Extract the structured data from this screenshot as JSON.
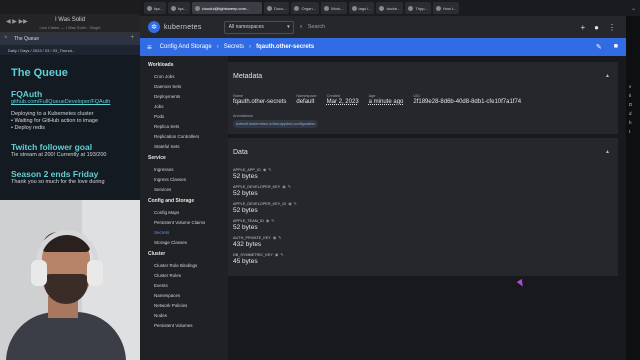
{
  "music": {
    "title": "I Was Solid",
    "subtitle": "Lew Clarke — I Was Solid - Single"
  },
  "obsidian": {
    "tab_label": "The Queue",
    "breadcrumb": "Daily / Days / 2023 / 03 / 03_Thursd...",
    "title": "The Queue",
    "section1_title": "FQAuth",
    "section1_link": "github.com/FullQueueDeveloper/FQAuth",
    "section1_lines": [
      "Deploying to a Kubernetes cluster",
      "• Waiting for GitHub action to image",
      "• Deploy redis"
    ],
    "section2_title": "Twitch follower goal",
    "section2_text": "Tie stream at 200! Currently at 193/200",
    "section3_title": "Season 2 ends Friday",
    "section3_text": "Thank you so much for the love during"
  },
  "browser": {
    "tabs": [
      "fqa...",
      "fqa...",
      "cloudui@lightsweep.com...",
      "Docu...",
      "Organ...",
      "Work...",
      "tags i...",
      "docke...",
      "Tripp...",
      "How t..."
    ]
  },
  "header": {
    "app_name": "kubernetes",
    "namespace": "All namespaces",
    "search_placeholder": "Search"
  },
  "breadcrumb": {
    "first": "Config And Storage",
    "second": "Secrets",
    "current": "fqauth.other-secrets"
  },
  "sidenav": [
    {
      "type": "section",
      "label": "Workloads"
    },
    {
      "type": "item",
      "label": "Cron Jobs"
    },
    {
      "type": "item",
      "label": "Daemon Sets"
    },
    {
      "type": "item",
      "label": "Deployments"
    },
    {
      "type": "item",
      "label": "Jobs"
    },
    {
      "type": "item",
      "label": "Pods"
    },
    {
      "type": "item",
      "label": "Replica Sets"
    },
    {
      "type": "item",
      "label": "Replication Controllers"
    },
    {
      "type": "item",
      "label": "Stateful Sets"
    },
    {
      "type": "section",
      "label": "Service"
    },
    {
      "type": "item",
      "label": "Ingresses"
    },
    {
      "type": "item",
      "label": "Ingress Classes"
    },
    {
      "type": "item",
      "label": "Services"
    },
    {
      "type": "section",
      "label": "Config and Storage"
    },
    {
      "type": "item",
      "label": "Config Maps"
    },
    {
      "type": "item",
      "label": "Persistent Volume Claims"
    },
    {
      "type": "item",
      "label": "Secrets",
      "selected": true
    },
    {
      "type": "item",
      "label": "Storage Classes"
    },
    {
      "type": "section",
      "label": "Cluster"
    },
    {
      "type": "item",
      "label": "Cluster Role Bindings"
    },
    {
      "type": "item",
      "label": "Cluster Roles"
    },
    {
      "type": "item",
      "label": "Events"
    },
    {
      "type": "item",
      "label": "Namespaces"
    },
    {
      "type": "item",
      "label": "Network Policies"
    },
    {
      "type": "item",
      "label": "Nodes"
    },
    {
      "type": "item",
      "label": "Persistent Volumes"
    }
  ],
  "metadata": {
    "title": "Metadata",
    "name_label": "Name",
    "name": "fqauth.other-secrets",
    "namespace_label": "Namespace",
    "namespace": "default",
    "created_label": "Created",
    "created": "Mar 2, 2023",
    "age_label": "Age",
    "age": "a minute ago",
    "uid_label": "UID",
    "uid": "2f189e28-8d6b-40d8-8db1-cfe10f7a1f74",
    "annotations_label": "Annotations",
    "annotation_chip": "kubectl.kubernetes.io/last-applied-configuration"
  },
  "data_section": {
    "title": "Data",
    "entries": [
      {
        "key": "APPLE_APP_ID",
        "size": "52 bytes"
      },
      {
        "key": "APPLE_DEVELOPER_KEY",
        "size": "52 bytes"
      },
      {
        "key": "APPLE_DEVELOPER_KEY_ID",
        "size": "52 bytes"
      },
      {
        "key": "APPLE_TEAM_ID",
        "size": "52 bytes"
      },
      {
        "key": "AUTH_PRIVATE_KEY",
        "size": "432 bytes"
      },
      {
        "key": "DB_SYMMETRIC_KEY",
        "size": "45 bytes"
      }
    ]
  },
  "right_gutter": [
    "v",
    "ti",
    "D",
    "d",
    "h",
    "t"
  ],
  "colors": {
    "accent": "#326ce5",
    "teal": "#5fd0d6",
    "selected_nav": "#5d95ff"
  }
}
